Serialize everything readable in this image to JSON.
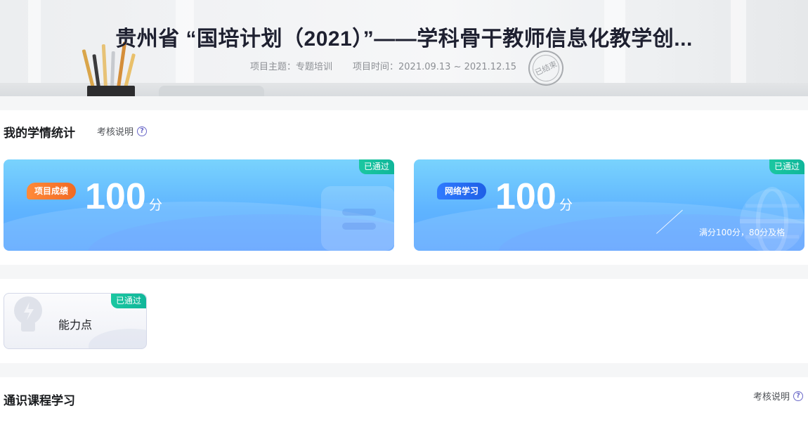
{
  "banner": {
    "title": "贵州省 “国培计划（2021）”——学科骨干教师信息化教学创...",
    "topic": "项目主题：专题培训",
    "period": "项目时间：2021.09.13 ~ 2021.12.15",
    "stamp": "已结束"
  },
  "stats": {
    "title": "我的学情统计",
    "explain": "考核说明",
    "project_card": {
      "tag": "项目成绩",
      "score": "100",
      "unit": "分",
      "badge": "已通过"
    },
    "online_card": {
      "tag": "网络学习",
      "score": "100",
      "unit": "分",
      "badge": "已通过",
      "pass_rule": "满分100分，80分及格"
    }
  },
  "ability": {
    "label": "能力点",
    "badge": "已通过"
  },
  "course": {
    "title": "通识课程学习",
    "explain": "考核说明"
  },
  "colors": {
    "accent_green": "#10b69a",
    "card_blue": "#5fb4ff",
    "tag_orange": "#f16a23",
    "tag_blue": "#1f5fe6"
  },
  "icons": [
    "help-circle-icon",
    "pencil-cup-image",
    "ended-stamp",
    "document-icon",
    "globe-icon",
    "lightbulb-icon"
  ]
}
